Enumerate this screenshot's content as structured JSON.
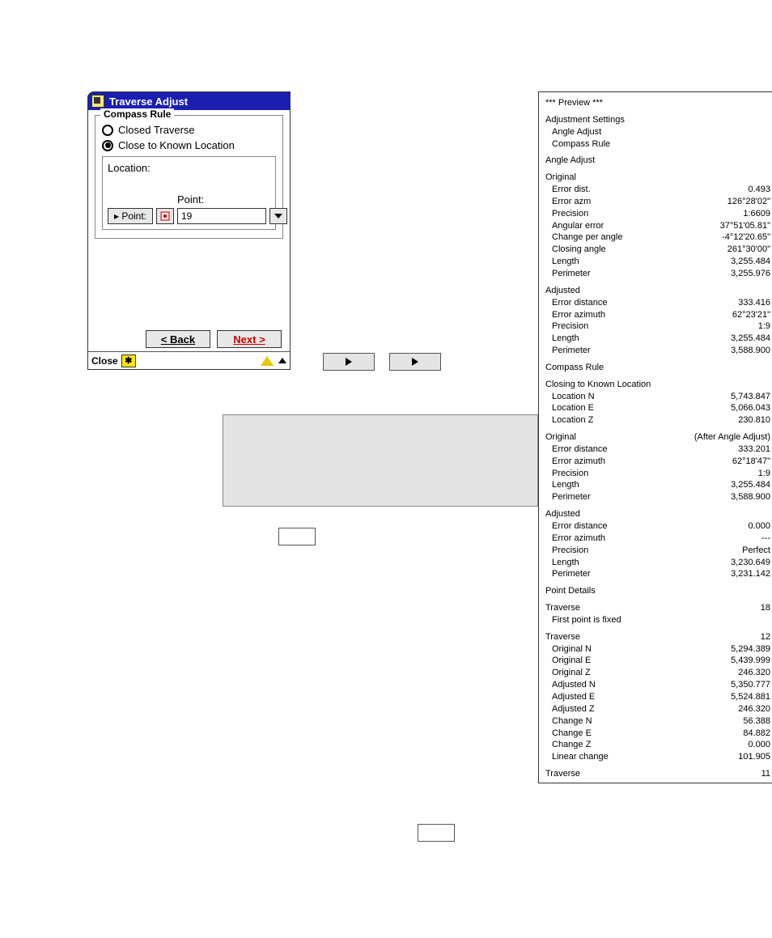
{
  "dialog": {
    "title": "Traverse Adjust",
    "fieldset": {
      "legend": "Compass Rule",
      "radio1_label": "Closed Traverse",
      "radio2_label": "Close to Known Location",
      "location_label": "Location:",
      "point_caption": "Point:",
      "point_btn_prefix": "▸ Point:",
      "point_value": "19"
    },
    "back_label": "< Back",
    "next_label": "Next >",
    "status_close": "Close",
    "status_star": "✱"
  },
  "preview": {
    "header": "*** Preview ***",
    "adj_settings_title": "Adjustment Settings",
    "adj_settings_l1": "Angle Adjust",
    "adj_settings_l2": "Compass Rule",
    "angle_adjust_title": "Angle Adjust",
    "original_title": "Original",
    "original_items": [
      {
        "k": "Error dist.",
        "v": "0.493"
      },
      {
        "k": "Error azm",
        "v": "126°28'02\""
      },
      {
        "k": "Precision",
        "v": "1:6609"
      },
      {
        "k": "Angular error",
        "v": "37°51'05.81\""
      },
      {
        "k": "Change per angle",
        "v": "-4°12'20.65\""
      },
      {
        "k": "Closing angle",
        "v": "261°30'00\""
      },
      {
        "k": "Length",
        "v": "3,255.484"
      },
      {
        "k": "Perimeter",
        "v": "3,255.976"
      }
    ],
    "adjusted1_title": "Adjusted",
    "adjusted1_items": [
      {
        "k": "Error distance",
        "v": "333.416"
      },
      {
        "k": "Error azimuth",
        "v": "62°23'21\""
      },
      {
        "k": "Precision",
        "v": "1:9"
      },
      {
        "k": "Length",
        "v": "3,255.484"
      },
      {
        "k": "Perimeter",
        "v": "3,588.900"
      }
    ],
    "compass_rule_title": "Compass Rule",
    "closing_title": "Closing to Known Location",
    "closing_items": [
      {
        "k": "Location N",
        "v": "5,743.847"
      },
      {
        "k": "Location E",
        "v": "5,066.043"
      },
      {
        "k": "Location Z",
        "v": "230.810"
      }
    ],
    "original2_title": "Original",
    "original2_suffix": "(After Angle Adjust)",
    "original2_items": [
      {
        "k": "Error distance",
        "v": "333.201"
      },
      {
        "k": "Error azimuth",
        "v": "62°18'47\""
      },
      {
        "k": "Precision",
        "v": "1:9"
      },
      {
        "k": "Length",
        "v": "3,255.484"
      },
      {
        "k": "Perimeter",
        "v": "3,588.900"
      }
    ],
    "adjusted2_title": "Adjusted",
    "adjusted2_items": [
      {
        "k": "Error distance",
        "v": "0.000"
      },
      {
        "k": "Error azimuth",
        "v": "---"
      },
      {
        "k": "Precision",
        "v": "Perfect"
      },
      {
        "k": "Length",
        "v": "3,230.649"
      },
      {
        "k": "Perimeter",
        "v": "3,231.142"
      }
    ],
    "point_details_title": "Point Details",
    "trav18_title": "Traverse",
    "trav18_val": "18",
    "trav18_note": "First point is fixed",
    "trav12_title": "Traverse",
    "trav12_val": "12",
    "trav12_items": [
      {
        "k": "Original N",
        "v": "5,294.389"
      },
      {
        "k": "Original E",
        "v": "5,439.999"
      },
      {
        "k": "Original Z",
        "v": "246.320"
      },
      {
        "k": "Adjusted N",
        "v": "5,350.777"
      },
      {
        "k": "Adjusted E",
        "v": "5,524.881"
      },
      {
        "k": "Adjusted Z",
        "v": "246.320"
      },
      {
        "k": "Change N",
        "v": "56.388"
      },
      {
        "k": "Change E",
        "v": "84.882"
      },
      {
        "k": "Change Z",
        "v": "0.000"
      },
      {
        "k": "Linear change",
        "v": "101.905"
      }
    ],
    "trav11_title": "Traverse",
    "trav11_val": "11"
  }
}
